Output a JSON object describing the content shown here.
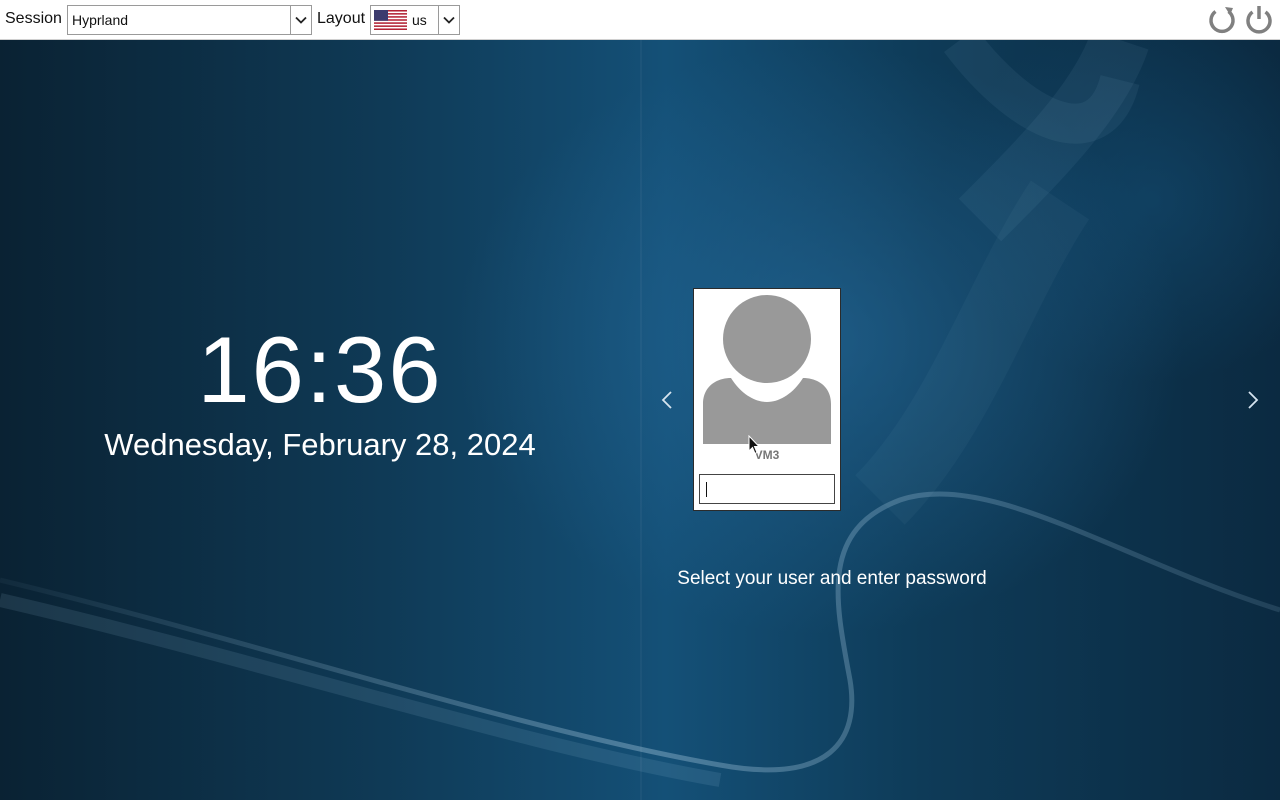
{
  "topbar": {
    "session_label": "Session",
    "session_value": "Hyprland",
    "layout_label": "Layout",
    "layout_value": "us",
    "layout_flag_icon": "us-flag-icon",
    "restart_icon": "restart-icon",
    "power_icon": "power-icon"
  },
  "clock": {
    "time": "16:36",
    "date": "Wednesday, February 28, 2024"
  },
  "user": {
    "name": "VM3",
    "avatar_icon": "user-avatar-icon",
    "password_value": ""
  },
  "nav": {
    "prev_icon": "chevron-left-icon",
    "next_icon": "chevron-right-icon"
  },
  "prompt": "Select your user and enter password",
  "colors": {
    "background_dark": "#0a2233",
    "background_accent": "#145077",
    "topbar": "#ffffff",
    "avatar_gray": "#999999",
    "icon_gray": "#808080"
  }
}
